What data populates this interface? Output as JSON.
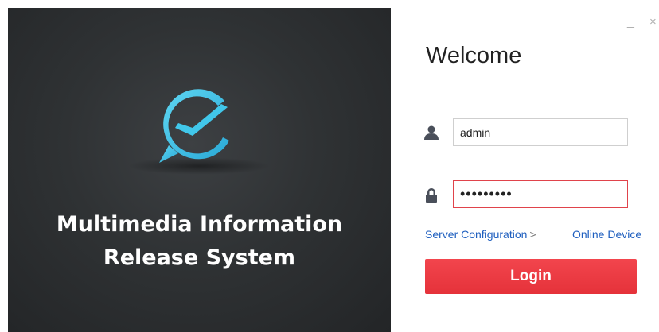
{
  "window": {
    "minimize_glyph": "_",
    "close_glyph": "×"
  },
  "branding": {
    "title_line1": "Multimedia Information",
    "title_line2": "Release System",
    "logo_icon": "chat-bubble-clock-icon",
    "logo_color": "#3ec6e8"
  },
  "login_form": {
    "welcome": "Welcome",
    "username_icon": "user-icon",
    "username_value": "admin",
    "password_icon": "lock-icon",
    "password_value": "•••••••••",
    "server_config_label": "Server Configuration",
    "server_config_chevron": ">",
    "online_device_label": "Online Device",
    "login_label": "Login"
  },
  "colors": {
    "accent_red": "#e8363e",
    "link_blue": "#1f5fbf",
    "dark_panel": "#2f3234"
  }
}
